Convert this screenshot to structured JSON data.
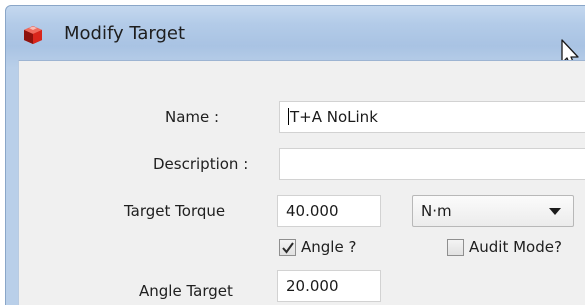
{
  "window": {
    "title": "Modify Target"
  },
  "form": {
    "name_label": "Name :",
    "name_value": "T+A NoLink",
    "description_label": "Description :",
    "description_value": "",
    "torque_label": "Target Torque",
    "torque_value": "40.000",
    "unit_selected": "N·m",
    "angle_checkbox_label": "Angle ?",
    "angle_checked": true,
    "audit_checkbox_label": "Audit Mode?",
    "audit_checked": false,
    "angle_target_label": "Angle Target",
    "angle_target_value": "20.000"
  },
  "colors": {
    "title_gradient": "#b3cbe8",
    "content_bg": "#f0f0f0",
    "icon_red": "#d9261c"
  },
  "icons": [
    "app-cube-icon",
    "mouse-cursor-icon",
    "dropdown-arrow-icon",
    "checkmark-icon"
  ]
}
